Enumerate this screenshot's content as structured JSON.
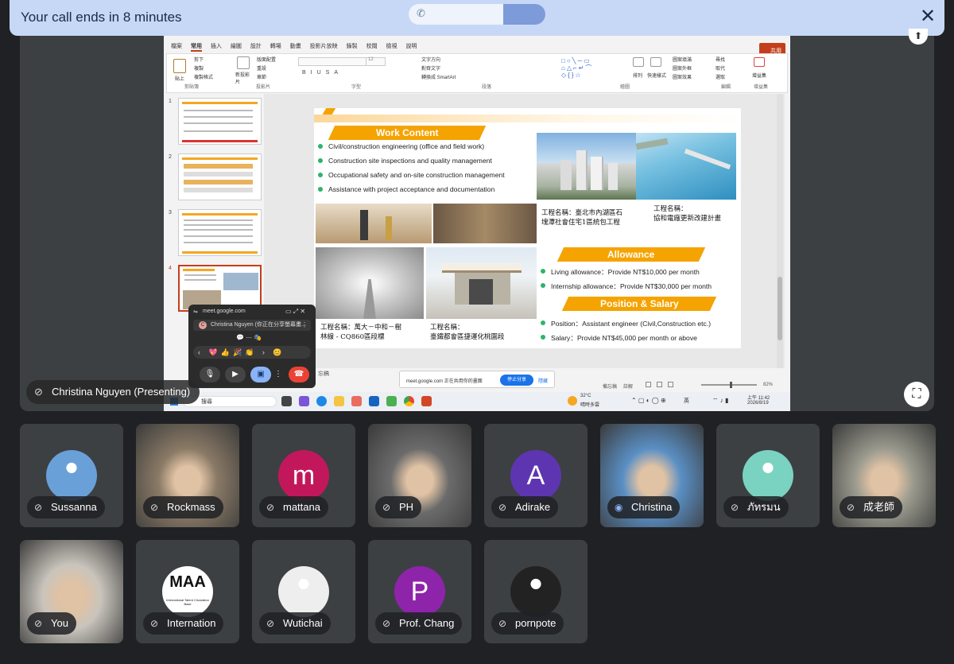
{
  "banner": {
    "text": "Your call ends in 8 minutes",
    "progress": 0.31,
    "close_icon": "close-icon"
  },
  "presenter": {
    "label": "Christina Nguyen (Presenting)"
  },
  "ppt": {
    "tabs": [
      "檔案",
      "常用",
      "插入",
      "繪圖",
      "設計",
      "轉場",
      "動畫",
      "投影片放映",
      "錄製",
      "校閱",
      "檢視",
      "說明"
    ],
    "active_tab": "常用",
    "share_label": "共用",
    "ribbon": {
      "cut": "剪下",
      "copy": "複製",
      "format_painter": "複製格式",
      "paste": "貼上",
      "new_slide": "新投影片",
      "layout": "版面配置",
      "reset": "重設",
      "section": "章節",
      "font_size": "12",
      "text_direction": "文字方向",
      "align_text": "對齊文字",
      "smartart": "轉換成 SmartArt",
      "arrange": "排列",
      "quick_styles": "快速樣式",
      "shape_fill": "圖案填滿",
      "shape_outline": "圖案外框",
      "shape_effects": "圖案效果",
      "find": "尋找",
      "replace": "取代",
      "select": "選取",
      "addin": "增益集",
      "groups": [
        "剪貼簿",
        "投影片",
        "字型",
        "段落",
        "繪圖",
        "編輯",
        "增益集"
      ]
    },
    "thumb_numbers": [
      "1",
      "2",
      "3",
      "4"
    ],
    "slide": {
      "work_title": "Work Content",
      "work_items": [
        "Civil/construction engineering (office and field work)",
        "Construction site inspections and quality management",
        "Occupational safety and on-site construction management",
        "Assistance with project acceptance and documentation"
      ],
      "captions": {
        "housing": "工程名稱：臺北市內湖區石\n塊潭社會住宅1區統包工程",
        "harbor": "工程名稱：\n協和電廠更新改建計畫",
        "tunnel": "工程名稱：萬大－中和－樹\n林線 - CQ860區段標",
        "station": "工程名稱：\n臺鐵都會區捷運化桃園段"
      },
      "allowance_title": "Allowance",
      "allowance_items": [
        "Living allowance：Provide NT$10,000 per month",
        "Internship allowance：Provide NT$30,000 per month"
      ],
      "position_title": "Position & Salary",
      "position_items": [
        "Position：Assistant engineer (Civil,Construction etc.)",
        "Salary：Provide NT$45,000 per month or above"
      ]
    },
    "notes_label": "忘稿",
    "status": {
      "notes": "備忘稿",
      "comments": "註解",
      "zoom": "82%"
    },
    "share_notice": {
      "text": "meet.google.com 正在共用你的畫面",
      "stop": "停止分享",
      "hide": "隱藏"
    },
    "taskbar": {
      "search_placeholder": "搜尋",
      "weather_temp": "32°C",
      "weather_desc": "晴時多雲",
      "ime": "英",
      "time": "上午 11:42",
      "date": "2026/8/19"
    }
  },
  "mini_panel": {
    "url": "meet.google.com",
    "tab_title": "Christina Nguyen (你正在分享螢幕畫...",
    "avatar_letter": "C",
    "reactions": [
      "💖",
      "👍",
      "🎉",
      "👏",
      "😊"
    ]
  },
  "participants": [
    {
      "name": "Sussanna",
      "type": "photo",
      "color": "#6aa0d8"
    },
    {
      "name": "Rockmass",
      "type": "video",
      "color": "#8a7a66"
    },
    {
      "name": "mattana",
      "type": "letter",
      "letter": "m",
      "color": "#c2185b"
    },
    {
      "name": "PH",
      "type": "video",
      "color": "#6b6b6b"
    },
    {
      "name": "Adirake",
      "type": "letter",
      "letter": "A",
      "color": "#5e35b1"
    },
    {
      "name": "Christina",
      "type": "video",
      "color": "#5a8fc4",
      "speaking": true
    },
    {
      "name": "ภัทรมน",
      "type": "photo",
      "color": "#7ad3c0"
    },
    {
      "name": "成老師",
      "type": "video",
      "color": "#9a9a8e"
    },
    {
      "name": "You",
      "type": "video",
      "color": "#c9c4bc"
    },
    {
      "name": "Internation",
      "type": "logo",
      "logo_text": "MAA",
      "logo_sub": "International Talent Circulation Base",
      "color": "#ffffff"
    },
    {
      "name": "Wutichai",
      "type": "photo",
      "color": "#eeeeee"
    },
    {
      "name": "Prof. Chang",
      "type": "letter",
      "letter": "P",
      "color": "#8e24aa"
    },
    {
      "name": "pornpote",
      "type": "photo",
      "color": "#222222"
    }
  ]
}
